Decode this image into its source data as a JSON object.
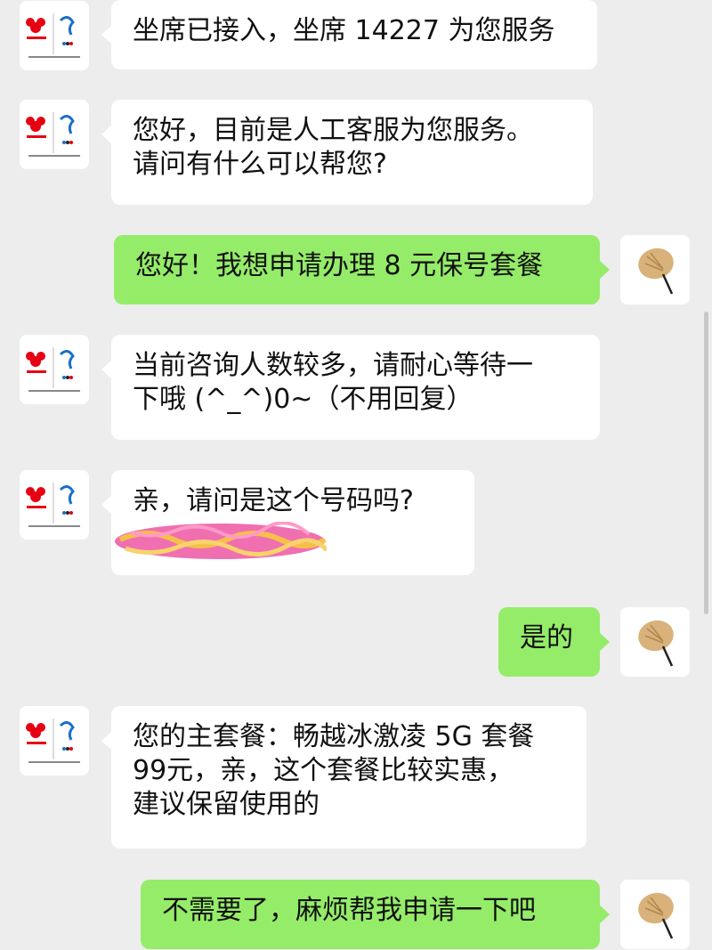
{
  "messages": [
    {
      "side": "in",
      "lines": [
        "坐席已接入，坐席 14227 为您服务"
      ]
    },
    {
      "side": "in",
      "lines": [
        "您好，目前是人工客服为您服务。",
        "请问有什么可以帮您?"
      ]
    },
    {
      "side": "out",
      "lines": [
        "您好！我想申请办理 8 元保号套餐"
      ]
    },
    {
      "side": "in",
      "lines": [
        "当前咨询人数较多，请耐心等待一",
        "下哦 (^_^)0~（不用回复）"
      ]
    },
    {
      "side": "in",
      "lines": [
        "亲，请问是这个号码吗?"
      ]
    },
    {
      "side": "out",
      "lines": [
        "是的"
      ]
    },
    {
      "side": "in",
      "lines": [
        "您的主套餐：畅越冰激凌 5G 套餐",
        "99元，亲，这个套餐比较实惠，",
        "建议保留使用的"
      ]
    },
    {
      "side": "out",
      "lines": [
        "不需要了，麻烦帮我申请一下吧"
      ]
    }
  ],
  "colors": {
    "background": "#ededed",
    "incoming_bubble": "#ffffff",
    "outgoing_bubble": "#95ec69",
    "text": "#111111"
  },
  "icons": {
    "agent_avatar": "china-unicom-beijing2022-logo-icon",
    "user_avatar": "palm-leaf-fan-icon",
    "redaction": "scribble-redaction-icon"
  }
}
